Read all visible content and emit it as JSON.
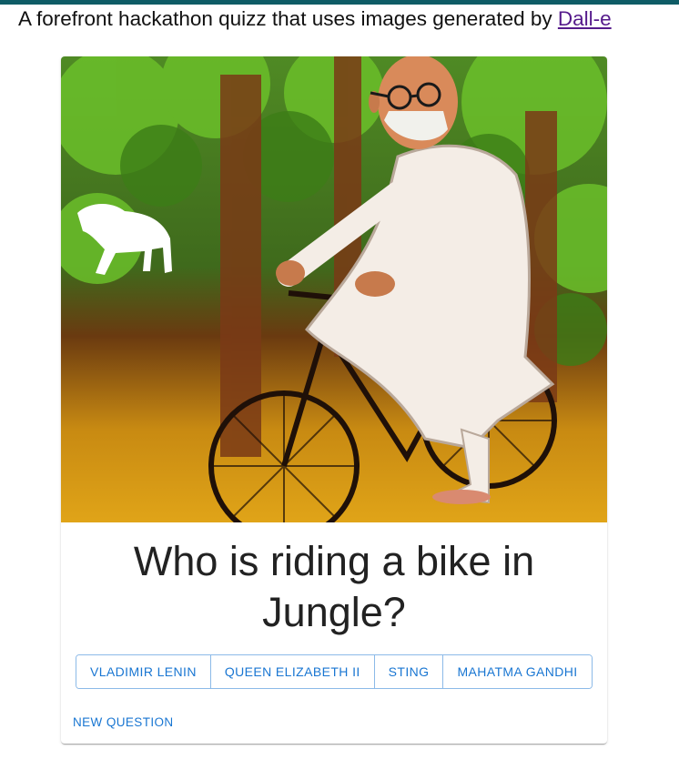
{
  "header": {
    "text": "A forefront hackathon quizz that uses images generated by ",
    "link_label": "Dall-e"
  },
  "quiz": {
    "question": "Who is riding a bike in Jungle?",
    "answers": [
      "VLADIMIR LENIN",
      "QUEEN ELIZABETH II",
      "STING",
      "MAHATMA GANDHI"
    ],
    "new_question_label": "NEW QUESTION"
  },
  "colors": {
    "topbar": "#0f5c66",
    "accent": "#1976d2",
    "link": "#551a8b"
  }
}
